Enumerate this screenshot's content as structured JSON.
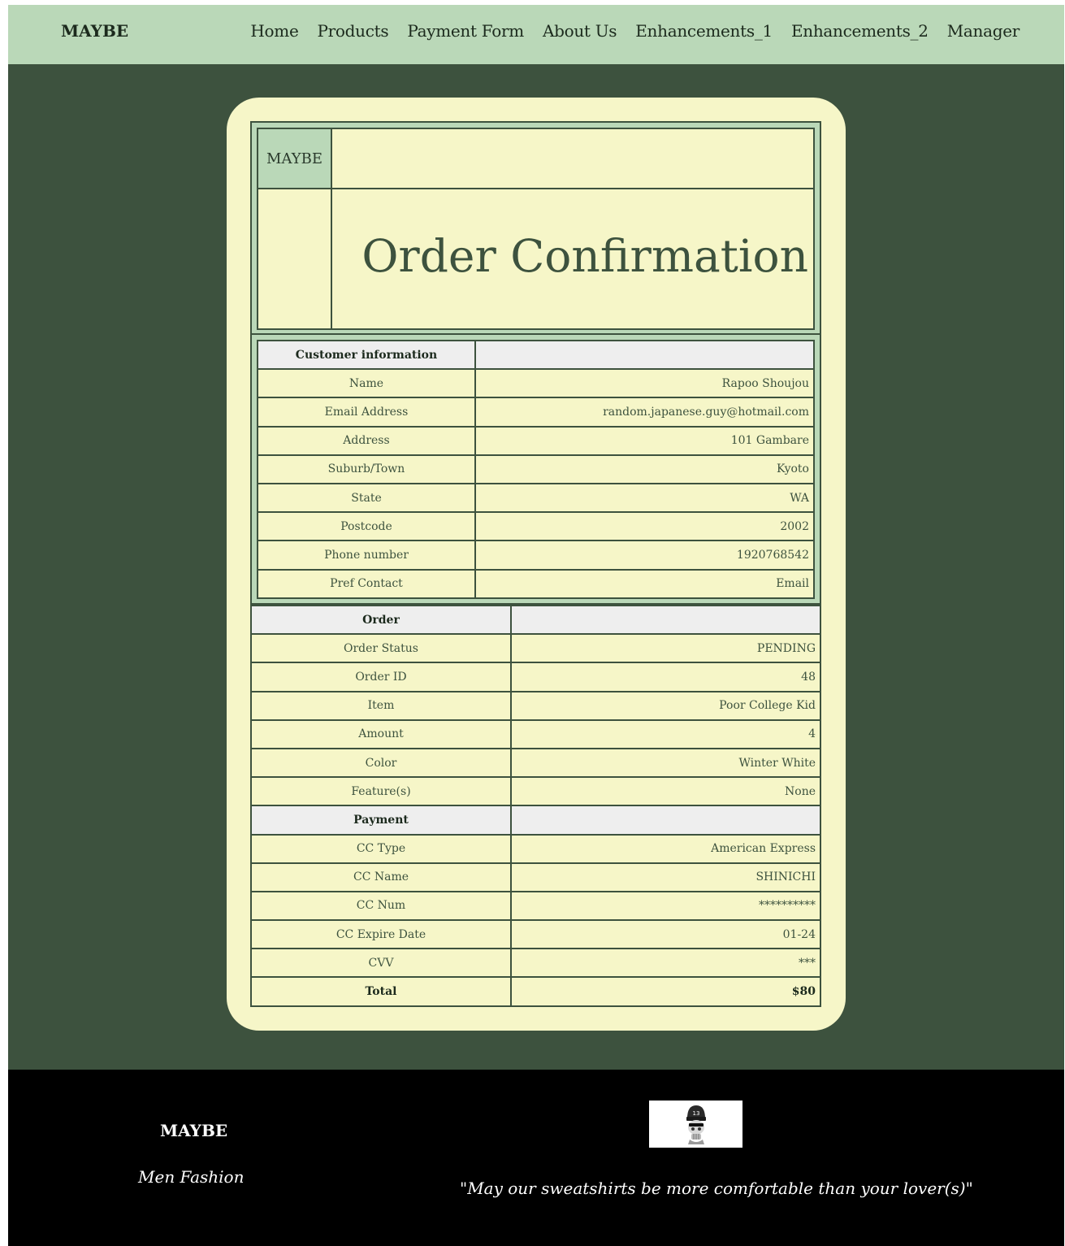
{
  "nav": {
    "brand": "MAYBE",
    "links": [
      "Home",
      "Products",
      "Payment Form",
      "About Us",
      "Enhancements_1",
      "Enhancements_2",
      "Manager"
    ]
  },
  "card": {
    "logo_text": "MAYBE",
    "title": "Order Confirmation"
  },
  "customer": {
    "header": "Customer information",
    "rows": [
      {
        "label": "Name",
        "value": "Rapoo Shoujou"
      },
      {
        "label": "Email Address",
        "value": "random.japanese.guy@hotmail.com"
      },
      {
        "label": "Address",
        "value": "101 Gambare"
      },
      {
        "label": "Suburb/Town",
        "value": "Kyoto"
      },
      {
        "label": "State",
        "value": "WA"
      },
      {
        "label": "Postcode",
        "value": "2002"
      },
      {
        "label": "Phone number",
        "value": "1920768542"
      },
      {
        "label": "Pref Contact",
        "value": "Email"
      }
    ]
  },
  "order": {
    "header": "Order",
    "rows": [
      {
        "label": "Order Status",
        "value": "PENDING"
      },
      {
        "label": "Order ID",
        "value": "48"
      },
      {
        "label": "Item",
        "value": "Poor College Kid"
      },
      {
        "label": "Amount",
        "value": "4"
      },
      {
        "label": "Color",
        "value": "Winter White"
      },
      {
        "label": "Feature(s)",
        "value": "None"
      }
    ]
  },
  "payment": {
    "header": "Payment",
    "rows": [
      {
        "label": "CC Type",
        "value": "American Express"
      },
      {
        "label": "CC Name",
        "value": "SHINICHI"
      },
      {
        "label": "CC Num",
        "value": "**********"
      },
      {
        "label": "CC Expire Date",
        "value": "01-24"
      },
      {
        "label": "CVV",
        "value": "***"
      }
    ],
    "total_label": "Total",
    "total_value": "$80"
  },
  "footer": {
    "brand": "MAYBE",
    "tagline": "Men Fashion",
    "quote": "\"May our sweatshirts be more comfortable than your lover(s)\"",
    "logo_icon": "skull-beanie-icon"
  },
  "colors": {
    "nav_bg": "#bad8b8",
    "main_bg": "#3d523e",
    "card_bg": "#f6f6c8",
    "header_cell_bg": "#eeeeee",
    "footer_bg": "#000000"
  }
}
